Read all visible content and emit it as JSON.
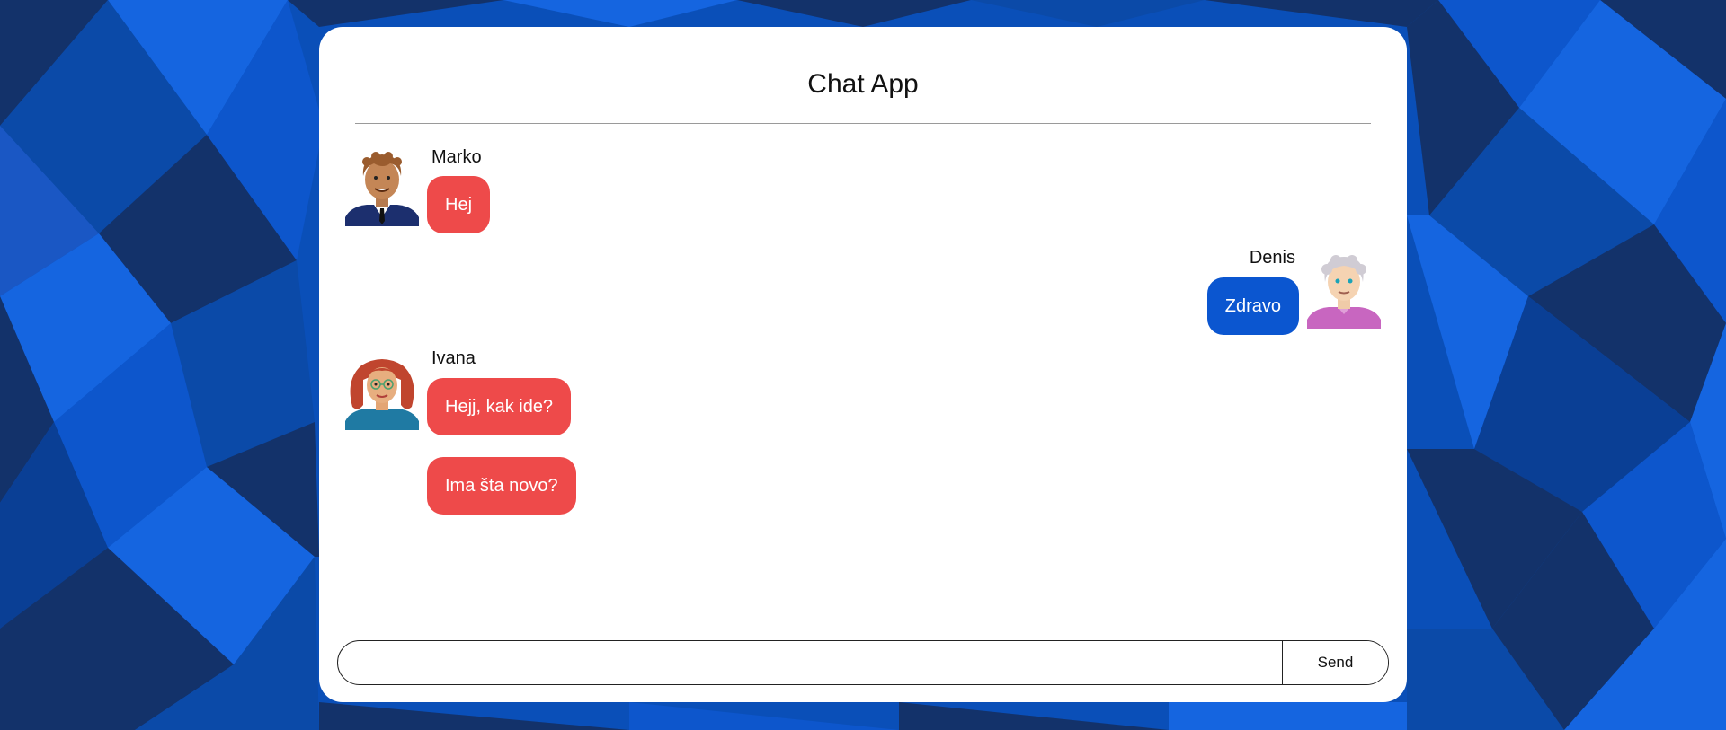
{
  "app": {
    "title": "Chat App"
  },
  "messages": [
    {
      "sender": "Marko",
      "avatar": "man-curly-hair-suit-avatar",
      "direction": "incoming",
      "texts": [
        "Hej"
      ]
    },
    {
      "sender": "Denis",
      "avatar": "elderly-woman-gray-hair-avatar",
      "direction": "outgoing",
      "texts": [
        "Zdravo"
      ]
    },
    {
      "sender": "Ivana",
      "avatar": "woman-red-curly-hair-glasses-avatar",
      "direction": "incoming",
      "texts": [
        "Hejj, kak ide?",
        "Ima šta novo?"
      ]
    }
  ],
  "composer": {
    "value": "",
    "placeholder": "",
    "send_label": "Send"
  },
  "colors": {
    "incoming_bubble": "#ee4a4a",
    "outgoing_bubble": "#0b56d0",
    "background_dark": "#13326a",
    "background_mid": "#0a4fb8",
    "background_light": "#1565e0",
    "card": "#ffffff"
  }
}
